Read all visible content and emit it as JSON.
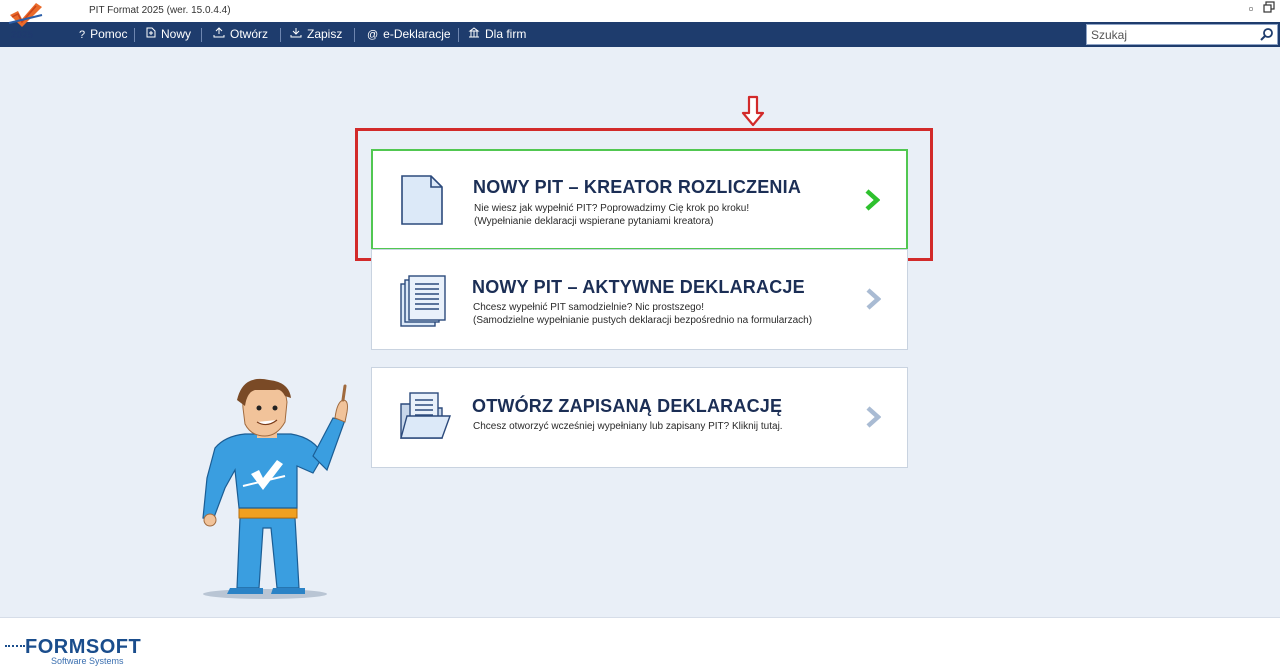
{
  "window": {
    "title": "PIT Format 2025 (wer. 15.0.4.4)",
    "logo_year": "2025",
    "controls": [
      "restore-icon",
      "maximize-icon"
    ]
  },
  "toolbar": {
    "items": [
      {
        "label": "Pomoc",
        "icon": "?"
      },
      {
        "label": "Nowy",
        "icon": "new-document-icon"
      },
      {
        "label": "Otwórz",
        "icon": "open-icon"
      },
      {
        "label": "Zapisz",
        "icon": "save-icon"
      },
      {
        "label": "e-Deklaracje",
        "icon": "at-icon"
      },
      {
        "label": "Dla firm",
        "icon": "building-icon"
      }
    ],
    "search_placeholder": "Szukaj"
  },
  "cards": [
    {
      "title": "NOWY PIT – KREATOR ROZLICZENIA",
      "line1": "Nie wiesz jak wypełnić PIT? Poprowadzimy Cię krok po kroku!",
      "line2": "(Wypełnianie deklaracji wspierane pytaniami kreatora)",
      "active": true
    },
    {
      "title": "NOWY PIT – AKTYWNE DEKLARACJE",
      "line1": "Chcesz wypełnić PIT samodzielnie? Nic prostszego!",
      "line2": "(Samodzielne wypełnianie pustych deklaracji bezpośrednio na formularzach)",
      "active": false
    },
    {
      "title": "OTWÓRZ ZAPISANĄ DEKLARACJĘ",
      "line1": "Chcesz otworzyć wcześniej wypełniany lub zapisany PIT? Kliknij tutaj.",
      "line2": "",
      "active": false
    }
  ],
  "footer": {
    "brand": "FORMSOFT",
    "brand_sub": "Software Systems"
  },
  "colors": {
    "toolbar_bg": "#1e3c6d",
    "page_bg": "#e9eff7",
    "active_border": "#51c751",
    "highlight": "#d22a2a",
    "title_text": "#1b2e55"
  }
}
